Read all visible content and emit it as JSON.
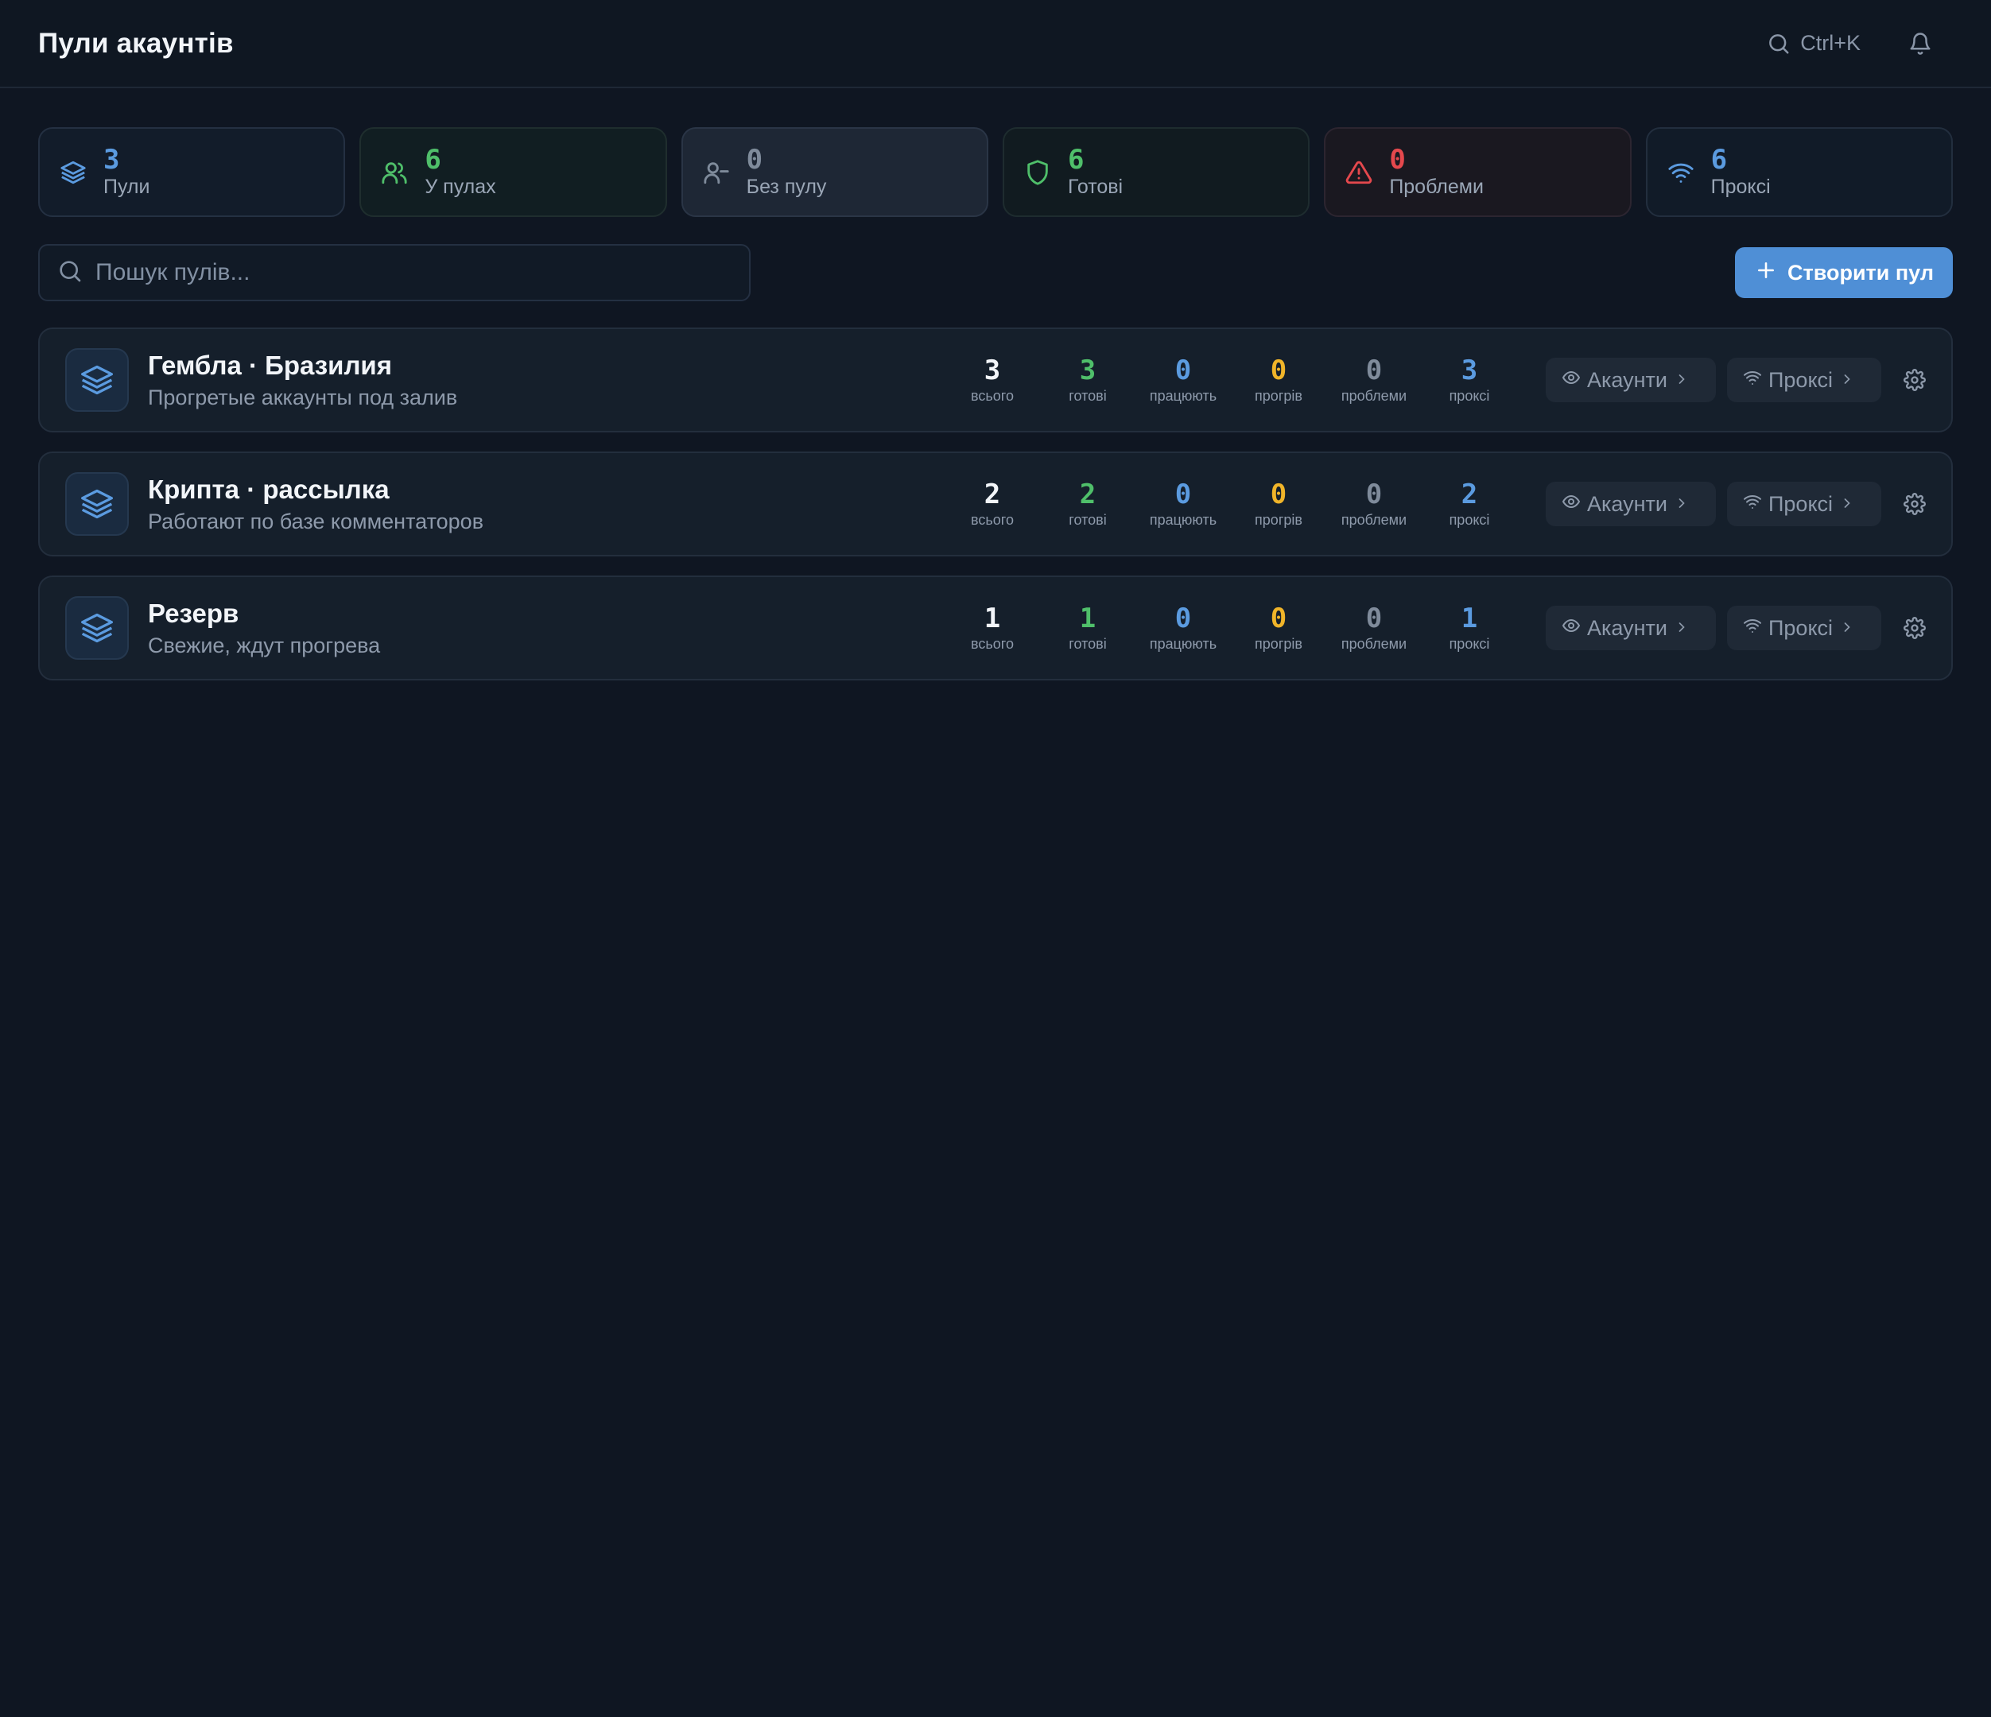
{
  "header": {
    "title": "Пули акаунтів",
    "search_shortcut": "Ctrl+K"
  },
  "colors": {
    "blue": "#5b9be0",
    "green": "#4fbf6a",
    "gray": "#7f8b9b",
    "yellow": "#f0b429",
    "red": "#e5484d",
    "white": "#f2f5f9",
    "accent": "#4f8fd6"
  },
  "stats": [
    {
      "value": "3",
      "label": "Пули",
      "icon": "layers-icon"
    },
    {
      "value": "6",
      "label": "У пулах",
      "icon": "users-icon"
    },
    {
      "value": "0",
      "label": "Без пулу",
      "icon": "user-minus-icon"
    },
    {
      "value": "6",
      "label": "Готові",
      "icon": "shield-icon"
    },
    {
      "value": "0",
      "label": "Проблеми",
      "icon": "alert-triangle-icon"
    },
    {
      "value": "6",
      "label": "Проксі",
      "icon": "wifi-icon"
    }
  ],
  "search": {
    "placeholder": "Пошук пулів..."
  },
  "create_button": {
    "label": "Створити пул"
  },
  "metric_labels": {
    "total": "всього",
    "ready": "готові",
    "working": "працюють",
    "warming": "прогрів",
    "problems": "проблеми",
    "proxies": "проксі"
  },
  "row_buttons": {
    "accounts": "Акаунти",
    "proxies": "Проксі"
  },
  "pools": [
    {
      "name": "Гембла · Бразилия",
      "description": "Прогретые аккаунты под залив",
      "metrics": {
        "total": "3",
        "ready": "3",
        "working": "0",
        "warming": "0",
        "problems": "0",
        "proxies": "3"
      }
    },
    {
      "name": "Крипта · рассылка",
      "description": "Работают по базе комментаторов",
      "metrics": {
        "total": "2",
        "ready": "2",
        "working": "0",
        "warming": "0",
        "problems": "0",
        "proxies": "2"
      }
    },
    {
      "name": "Резерв",
      "description": "Свежие, ждут прогрева",
      "metrics": {
        "total": "1",
        "ready": "1",
        "working": "0",
        "warming": "0",
        "problems": "0",
        "proxies": "1"
      }
    }
  ]
}
